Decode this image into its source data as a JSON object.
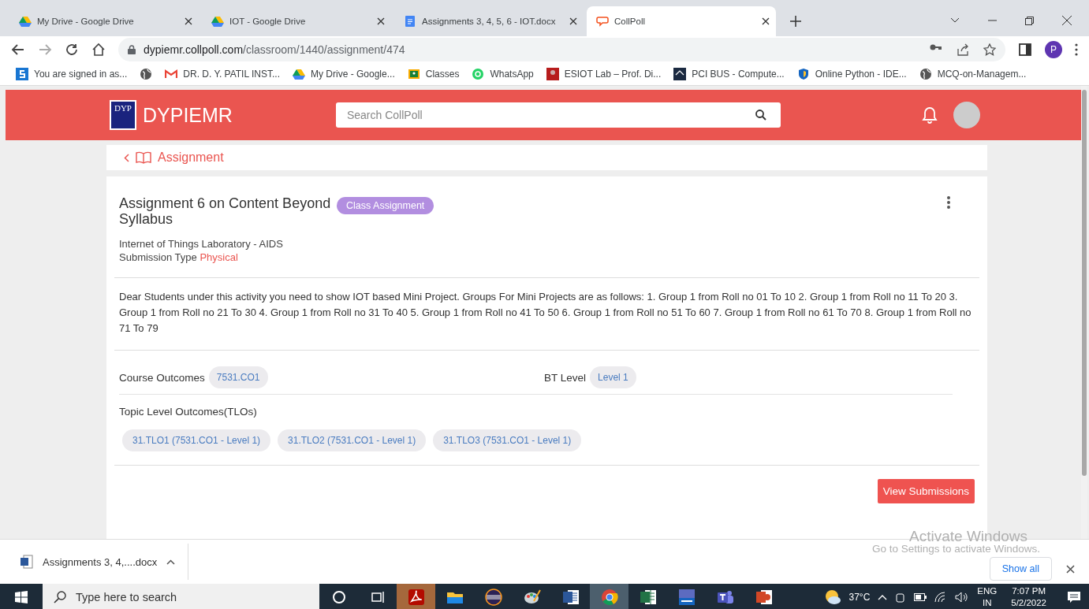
{
  "browser": {
    "tabs": [
      {
        "title": "My Drive - Google Drive",
        "kind": "drive",
        "selected": false
      },
      {
        "title": "IOT - Google Drive",
        "kind": "drive",
        "selected": false
      },
      {
        "title": "Assignments 3, 4, 5, 6 - IOT.docx",
        "kind": "docs",
        "selected": false
      },
      {
        "title": "CollPoll",
        "kind": "collpoll",
        "selected": true
      }
    ],
    "url_host": "dypiemr.collpoll.com",
    "url_path": "/classroom/1440/assignment/474",
    "profile_initial": "P",
    "bookmarks": [
      {
        "label": "You are signed in as...",
        "kind": "s"
      },
      {
        "kind": "globe"
      },
      {
        "label": "DR. D. Y. PATIL INST...",
        "kind": "gmail"
      },
      {
        "label": "My Drive - Google...",
        "kind": "drive"
      },
      {
        "label": "Classes",
        "kind": "classroom"
      },
      {
        "label": "WhatsApp",
        "kind": "whatsapp"
      },
      {
        "label": "ESIOT Lab – Prof. Di...",
        "kind": "photo"
      },
      {
        "label": "PCI BUS - Compute...",
        "kind": "sf"
      },
      {
        "label": "Online Python - IDE...",
        "kind": "shield"
      },
      {
        "label": "MCQ-on-Managem...",
        "kind": "globe"
      }
    ]
  },
  "header": {
    "logo_text": "DYP",
    "brand": "DYPIEMR",
    "search_placeholder": "Search CollPoll"
  },
  "breadcrumb": "Assignment",
  "assignment": {
    "title": "Assignment 6 on Content Beyond Syllabus",
    "badge": "Class Assignment",
    "course": "Internet of Things Laboratory - AIDS",
    "submission_label": "Submission Type",
    "submission_value": "Physical",
    "description": "Dear Students under this activity you need to show IOT based Mini Project. Groups For Mini Projects are as follows: 1. Group 1 from Roll no 01 To 10 2. Group 1 from Roll no 11 To 20 3. Group 1 from Roll no 21 To 30 4. Group 1 from Roll no 31 To 40 5. Group 1 from Roll no 41 To 50 6. Group 1 from Roll no 51 To 60 7. Group 1 from Roll no 61 To 70 8. Group 1 from Roll no 71 To 79",
    "course_outcomes_label": "Course Outcomes",
    "course_outcomes": [
      "7531.CO1"
    ],
    "bt_level_label": "BT Level",
    "bt_levels": [
      "Level 1"
    ],
    "tlo_label": "Topic Level Outcomes(TLOs)",
    "tlos": [
      "31.TLO1 (7531.CO1 - Level 1)",
      "31.TLO2 (7531.CO1 - Level 1)",
      "31.TLO3 (7531.CO1 - Level 1)"
    ],
    "button": "View Submissions"
  },
  "downloads": {
    "file": "Assignments 3, 4,....docx",
    "show_all": "Show all"
  },
  "activation": {
    "title": "Activate Windows",
    "subtitle": "Go to Settings to activate Windows."
  },
  "taskbar": {
    "search_placeholder": "Type here to search",
    "apps": [
      {
        "kind": "acrobat",
        "active": false,
        "flashing": true
      },
      {
        "kind": "explorer",
        "active": false,
        "flashing": false
      },
      {
        "kind": "eclipse",
        "active": false,
        "flashing": false
      },
      {
        "kind": "paint",
        "active": false,
        "flashing": false
      },
      {
        "kind": "word",
        "active": false,
        "flashing": false
      },
      {
        "kind": "chrome",
        "active": true,
        "flashing": false
      },
      {
        "kind": "excel",
        "active": false,
        "flashing": false
      },
      {
        "kind": "devcpp",
        "active": false,
        "flashing": false
      },
      {
        "kind": "teams",
        "active": false,
        "flashing": false
      },
      {
        "kind": "powerpoint",
        "active": false,
        "flashing": false
      }
    ],
    "weather": "37°C",
    "lang": "ENG",
    "region": "IN",
    "time": "7:07 PM",
    "date": "5/2/2022"
  }
}
